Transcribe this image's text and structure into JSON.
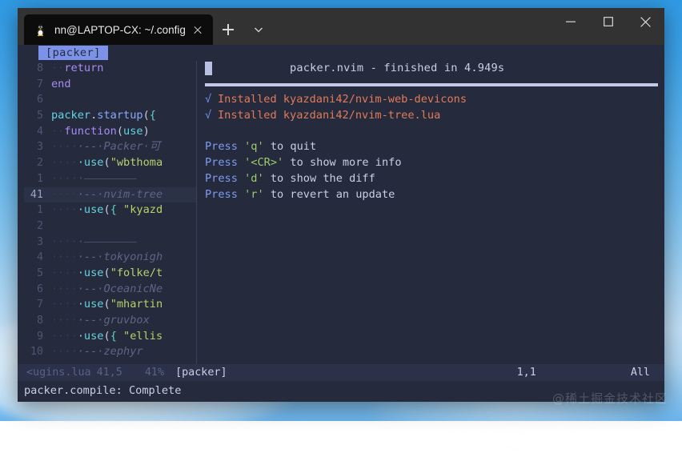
{
  "window": {
    "tab": {
      "title": "nn@LAPTOP-CX: ~/.config/nvim",
      "icon": "tux-icon",
      "close_icon": "close-icon"
    },
    "new_tab_icon": "plus-icon",
    "dropdown_icon": "chevron-down-icon",
    "controls": {
      "minimize": "minimize-icon",
      "maximize": "maximize-icon",
      "close": "close-icon"
    }
  },
  "nvim": {
    "tabline": {
      "active_tab": "[packer]"
    },
    "editor": {
      "lines": [
        {
          "nr": "8",
          "current": false,
          "tokens": [
            {
              "t": "ws",
              "v": "··"
            },
            {
              "t": "kw",
              "v": "return"
            }
          ]
        },
        {
          "nr": "7",
          "current": false,
          "tokens": [
            {
              "t": "kw",
              "v": "end"
            }
          ]
        },
        {
          "nr": "6",
          "current": false,
          "tokens": []
        },
        {
          "nr": "5",
          "current": false,
          "tokens": [
            {
              "t": "ident",
              "v": "packer"
            },
            {
              "t": "punct",
              "v": "."
            },
            {
              "t": "func",
              "v": "startup"
            },
            {
              "t": "punct",
              "v": "("
            },
            {
              "t": "brace",
              "v": "{"
            }
          ]
        },
        {
          "nr": "4",
          "current": false,
          "tokens": [
            {
              "t": "ws",
              "v": "··"
            },
            {
              "t": "kw",
              "v": "function"
            },
            {
              "t": "punct",
              "v": "("
            },
            {
              "t": "ident",
              "v": "use"
            },
            {
              "t": "punct",
              "v": ")"
            }
          ]
        },
        {
          "nr": "3",
          "current": false,
          "tokens": [
            {
              "t": "ws",
              "v": "····"
            },
            {
              "t": "comment",
              "v": "·--·Packer·可"
            }
          ]
        },
        {
          "nr": "2",
          "current": false,
          "tokens": [
            {
              "t": "ws",
              "v": "····"
            },
            {
              "t": "ident",
              "v": "·use"
            },
            {
              "t": "punct",
              "v": "("
            },
            {
              "t": "str",
              "v": "\"wbthoma"
            }
          ]
        },
        {
          "nr": "1",
          "current": false,
          "tokens": [
            {
              "t": "ws",
              "v": "····"
            },
            {
              "t": "rule",
              "v": "·————————"
            }
          ]
        },
        {
          "nr": "41",
          "current": true,
          "tokens": [
            {
              "t": "ws",
              "v": "····"
            },
            {
              "t": "comment",
              "v": "·--·nvim-tree"
            }
          ]
        },
        {
          "nr": "1",
          "current": false,
          "tokens": [
            {
              "t": "ws",
              "v": "····"
            },
            {
              "t": "ident",
              "v": "·use"
            },
            {
              "t": "punct",
              "v": "("
            },
            {
              "t": "brace",
              "v": "{"
            },
            {
              "t": "str",
              "v": " \"kyazd"
            }
          ]
        },
        {
          "nr": "2",
          "current": false,
          "tokens": []
        },
        {
          "nr": "3",
          "current": false,
          "tokens": [
            {
              "t": "ws",
              "v": "····"
            },
            {
              "t": "rule",
              "v": "·————————"
            }
          ]
        },
        {
          "nr": "4",
          "current": false,
          "tokens": [
            {
              "t": "ws",
              "v": "····"
            },
            {
              "t": "comment",
              "v": "·--·tokyonigh"
            }
          ]
        },
        {
          "nr": "5",
          "current": false,
          "tokens": [
            {
              "t": "ws",
              "v": "····"
            },
            {
              "t": "ident",
              "v": "·use"
            },
            {
              "t": "punct",
              "v": "("
            },
            {
              "t": "str",
              "v": "\"folke/t"
            }
          ]
        },
        {
          "nr": "6",
          "current": false,
          "tokens": [
            {
              "t": "ws",
              "v": "····"
            },
            {
              "t": "comment",
              "v": "·--·OceanicNe"
            }
          ]
        },
        {
          "nr": "7",
          "current": false,
          "tokens": [
            {
              "t": "ws",
              "v": "····"
            },
            {
              "t": "ident",
              "v": "·use"
            },
            {
              "t": "punct",
              "v": "("
            },
            {
              "t": "str",
              "v": "\"mhartin"
            }
          ]
        },
        {
          "nr": "8",
          "current": false,
          "tokens": [
            {
              "t": "ws",
              "v": "····"
            },
            {
              "t": "comment",
              "v": "·--·gruvbox"
            }
          ]
        },
        {
          "nr": "9",
          "current": false,
          "tokens": [
            {
              "t": "ws",
              "v": "····"
            },
            {
              "t": "ident",
              "v": "·use"
            },
            {
              "t": "punct",
              "v": "("
            },
            {
              "t": "brace",
              "v": "{"
            },
            {
              "t": "str",
              "v": " \"ellis"
            }
          ]
        },
        {
          "nr": "10",
          "current": false,
          "tokens": [
            {
              "t": "ws",
              "v": "····"
            },
            {
              "t": "comment",
              "v": "·--·zephyr"
            }
          ]
        }
      ]
    },
    "packer": {
      "headline": "packer.nvim - finished in 4.949s",
      "installs": [
        {
          "check": "√",
          "text": "Installed kyazdani42/nvim-web-devicons"
        },
        {
          "check": "√",
          "text": "Installed kyazdani42/nvim-tree.lua"
        }
      ],
      "hints": [
        {
          "word": "Press ",
          "key": "'q'",
          "rest": " to quit"
        },
        {
          "word": "Press ",
          "key": "'<CR>'",
          "rest": " to show more info"
        },
        {
          "word": "Press ",
          "key": "'d'",
          "rest": " to show the diff"
        },
        {
          "word": "Press ",
          "key": "'r'",
          "rest": " to revert an update"
        }
      ]
    },
    "status": {
      "file": "<ugins.lua",
      "position_left": "41,5",
      "percent": "41%",
      "buffer": "[packer]",
      "position_right": "1,1",
      "view": "All"
    },
    "cmdline": "packer.compile: Complete"
  },
  "watermark": "@稀土掘金技术社区"
}
